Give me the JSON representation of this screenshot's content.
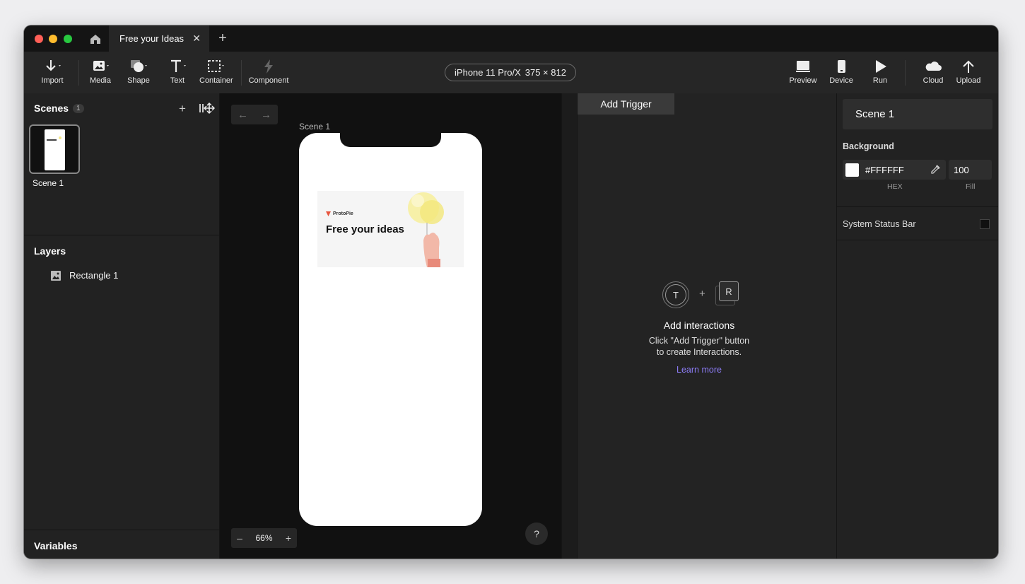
{
  "window": {
    "tab_title": "Free your Ideas"
  },
  "toolbar": {
    "import_label": "Import",
    "media_label": "Media",
    "shape_label": "Shape",
    "text_label": "Text",
    "container_label": "Container",
    "component_label": "Component",
    "device_name": "iPhone 11 Pro/X",
    "device_size": "375 × 812",
    "preview_label": "Preview",
    "device_label": "Device",
    "run_label": "Run",
    "cloud_label": "Cloud",
    "upload_label": "Upload"
  },
  "scenes": {
    "title": "Scenes",
    "count": "1",
    "items": [
      {
        "label": "Scene 1"
      }
    ]
  },
  "layers": {
    "title": "Layers",
    "items": [
      {
        "label": "Rectangle 1",
        "icon": "image-icon"
      }
    ]
  },
  "variables": {
    "title": "Variables"
  },
  "canvas": {
    "scene_label": "Scene 1",
    "banner_brand": "ProtoPie",
    "banner_headline": "Free your ideas",
    "zoom": "66%",
    "help": "?"
  },
  "interactions": {
    "add_trigger_label": "Add Trigger",
    "trigger_glyph": "T",
    "response_glyph": "R",
    "plus": "+",
    "empty_title": "Add interactions",
    "empty_line1": "Click \"Add Trigger\" button",
    "empty_line2": "to create Interactions.",
    "learn_more": "Learn more"
  },
  "properties": {
    "scene_name": "Scene 1",
    "background_label": "Background",
    "hex_value": "#FFFFFF",
    "fill_value": "100",
    "hex_caption": "HEX",
    "fill_caption": "Fill",
    "status_bar_label": "System Status Bar"
  },
  "colors": {
    "accent_link": "#8c7cf6",
    "background_swatch": "#FFFFFF"
  }
}
